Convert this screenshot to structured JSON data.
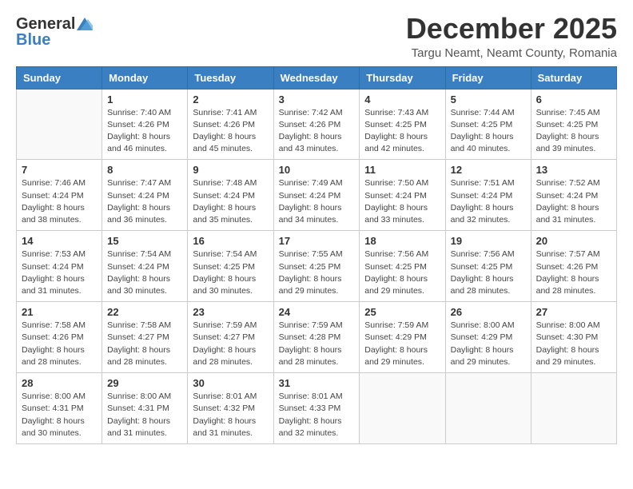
{
  "header": {
    "logo_general": "General",
    "logo_blue": "Blue",
    "month_title": "December 2025",
    "location": "Targu Neamt, Neamt County, Romania"
  },
  "days_of_week": [
    "Sunday",
    "Monday",
    "Tuesday",
    "Wednesday",
    "Thursday",
    "Friday",
    "Saturday"
  ],
  "weeks": [
    [
      {
        "day": "",
        "info": ""
      },
      {
        "day": "1",
        "info": "Sunrise: 7:40 AM\nSunset: 4:26 PM\nDaylight: 8 hours\nand 46 minutes."
      },
      {
        "day": "2",
        "info": "Sunrise: 7:41 AM\nSunset: 4:26 PM\nDaylight: 8 hours\nand 45 minutes."
      },
      {
        "day": "3",
        "info": "Sunrise: 7:42 AM\nSunset: 4:26 PM\nDaylight: 8 hours\nand 43 minutes."
      },
      {
        "day": "4",
        "info": "Sunrise: 7:43 AM\nSunset: 4:25 PM\nDaylight: 8 hours\nand 42 minutes."
      },
      {
        "day": "5",
        "info": "Sunrise: 7:44 AM\nSunset: 4:25 PM\nDaylight: 8 hours\nand 40 minutes."
      },
      {
        "day": "6",
        "info": "Sunrise: 7:45 AM\nSunset: 4:25 PM\nDaylight: 8 hours\nand 39 minutes."
      }
    ],
    [
      {
        "day": "7",
        "info": "Sunrise: 7:46 AM\nSunset: 4:24 PM\nDaylight: 8 hours\nand 38 minutes."
      },
      {
        "day": "8",
        "info": "Sunrise: 7:47 AM\nSunset: 4:24 PM\nDaylight: 8 hours\nand 36 minutes."
      },
      {
        "day": "9",
        "info": "Sunrise: 7:48 AM\nSunset: 4:24 PM\nDaylight: 8 hours\nand 35 minutes."
      },
      {
        "day": "10",
        "info": "Sunrise: 7:49 AM\nSunset: 4:24 PM\nDaylight: 8 hours\nand 34 minutes."
      },
      {
        "day": "11",
        "info": "Sunrise: 7:50 AM\nSunset: 4:24 PM\nDaylight: 8 hours\nand 33 minutes."
      },
      {
        "day": "12",
        "info": "Sunrise: 7:51 AM\nSunset: 4:24 PM\nDaylight: 8 hours\nand 32 minutes."
      },
      {
        "day": "13",
        "info": "Sunrise: 7:52 AM\nSunset: 4:24 PM\nDaylight: 8 hours\nand 31 minutes."
      }
    ],
    [
      {
        "day": "14",
        "info": "Sunrise: 7:53 AM\nSunset: 4:24 PM\nDaylight: 8 hours\nand 31 minutes."
      },
      {
        "day": "15",
        "info": "Sunrise: 7:54 AM\nSunset: 4:24 PM\nDaylight: 8 hours\nand 30 minutes."
      },
      {
        "day": "16",
        "info": "Sunrise: 7:54 AM\nSunset: 4:25 PM\nDaylight: 8 hours\nand 30 minutes."
      },
      {
        "day": "17",
        "info": "Sunrise: 7:55 AM\nSunset: 4:25 PM\nDaylight: 8 hours\nand 29 minutes."
      },
      {
        "day": "18",
        "info": "Sunrise: 7:56 AM\nSunset: 4:25 PM\nDaylight: 8 hours\nand 29 minutes."
      },
      {
        "day": "19",
        "info": "Sunrise: 7:56 AM\nSunset: 4:25 PM\nDaylight: 8 hours\nand 28 minutes."
      },
      {
        "day": "20",
        "info": "Sunrise: 7:57 AM\nSunset: 4:26 PM\nDaylight: 8 hours\nand 28 minutes."
      }
    ],
    [
      {
        "day": "21",
        "info": "Sunrise: 7:58 AM\nSunset: 4:26 PM\nDaylight: 8 hours\nand 28 minutes."
      },
      {
        "day": "22",
        "info": "Sunrise: 7:58 AM\nSunset: 4:27 PM\nDaylight: 8 hours\nand 28 minutes."
      },
      {
        "day": "23",
        "info": "Sunrise: 7:59 AM\nSunset: 4:27 PM\nDaylight: 8 hours\nand 28 minutes."
      },
      {
        "day": "24",
        "info": "Sunrise: 7:59 AM\nSunset: 4:28 PM\nDaylight: 8 hours\nand 28 minutes."
      },
      {
        "day": "25",
        "info": "Sunrise: 7:59 AM\nSunset: 4:29 PM\nDaylight: 8 hours\nand 29 minutes."
      },
      {
        "day": "26",
        "info": "Sunrise: 8:00 AM\nSunset: 4:29 PM\nDaylight: 8 hours\nand 29 minutes."
      },
      {
        "day": "27",
        "info": "Sunrise: 8:00 AM\nSunset: 4:30 PM\nDaylight: 8 hours\nand 29 minutes."
      }
    ],
    [
      {
        "day": "28",
        "info": "Sunrise: 8:00 AM\nSunset: 4:31 PM\nDaylight: 8 hours\nand 30 minutes."
      },
      {
        "day": "29",
        "info": "Sunrise: 8:00 AM\nSunset: 4:31 PM\nDaylight: 8 hours\nand 31 minutes."
      },
      {
        "day": "30",
        "info": "Sunrise: 8:01 AM\nSunset: 4:32 PM\nDaylight: 8 hours\nand 31 minutes."
      },
      {
        "day": "31",
        "info": "Sunrise: 8:01 AM\nSunset: 4:33 PM\nDaylight: 8 hours\nand 32 minutes."
      },
      {
        "day": "",
        "info": ""
      },
      {
        "day": "",
        "info": ""
      },
      {
        "day": "",
        "info": ""
      }
    ]
  ]
}
